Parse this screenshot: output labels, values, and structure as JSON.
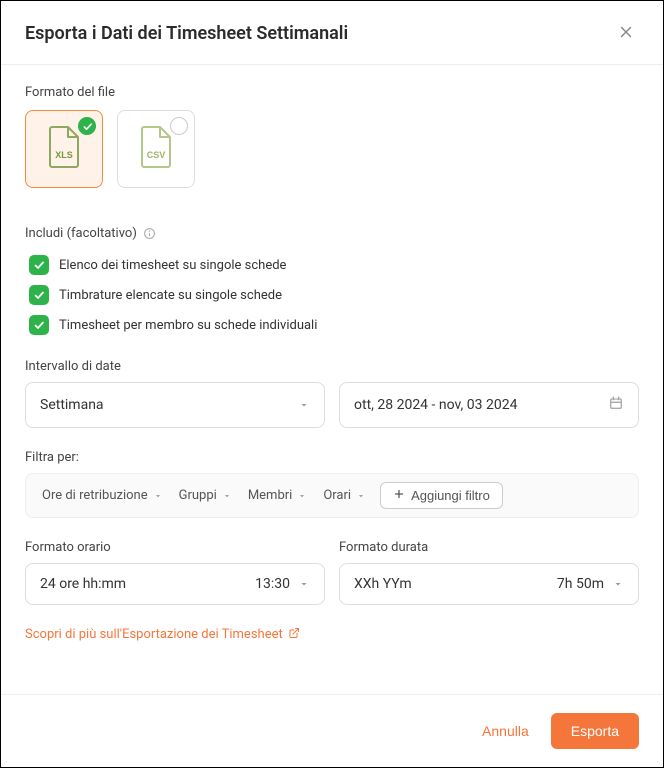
{
  "header": {
    "title": "Esporta i Dati dei Timesheet Settimanali"
  },
  "fileFormat": {
    "label": "Formato del file",
    "options": [
      {
        "id": "xls",
        "label": "XLS",
        "selected": true
      },
      {
        "id": "csv",
        "label": "CSV",
        "selected": false
      }
    ]
  },
  "include": {
    "label": "Includi (facoltativo)",
    "items": [
      {
        "label": "Elenco dei timesheet su singole schede",
        "checked": true
      },
      {
        "label": "Timbrature elencate su singole schede",
        "checked": true
      },
      {
        "label": "Timesheet per membro su schede individuali",
        "checked": true
      }
    ]
  },
  "dateRange": {
    "label": "Intervallo di date",
    "period": "Settimana",
    "value": "ott, 28 2024 - nov, 03 2024"
  },
  "filter": {
    "label": "Filtra per:",
    "chips": [
      "Ore di retribuzione",
      "Gruppi",
      "Membri",
      "Orari"
    ],
    "addLabel": "Aggiungi filtro"
  },
  "timeFormat": {
    "label": "Formato orario",
    "value": "24 ore hh:mm",
    "example": "13:30"
  },
  "durationFormat": {
    "label": "Formato durata",
    "value": "XXh YYm",
    "example": "7h 50m"
  },
  "learnMore": "Scopri di più sull'Esportazione dei Timesheet",
  "footer": {
    "cancel": "Annulla",
    "export": "Esporta"
  }
}
